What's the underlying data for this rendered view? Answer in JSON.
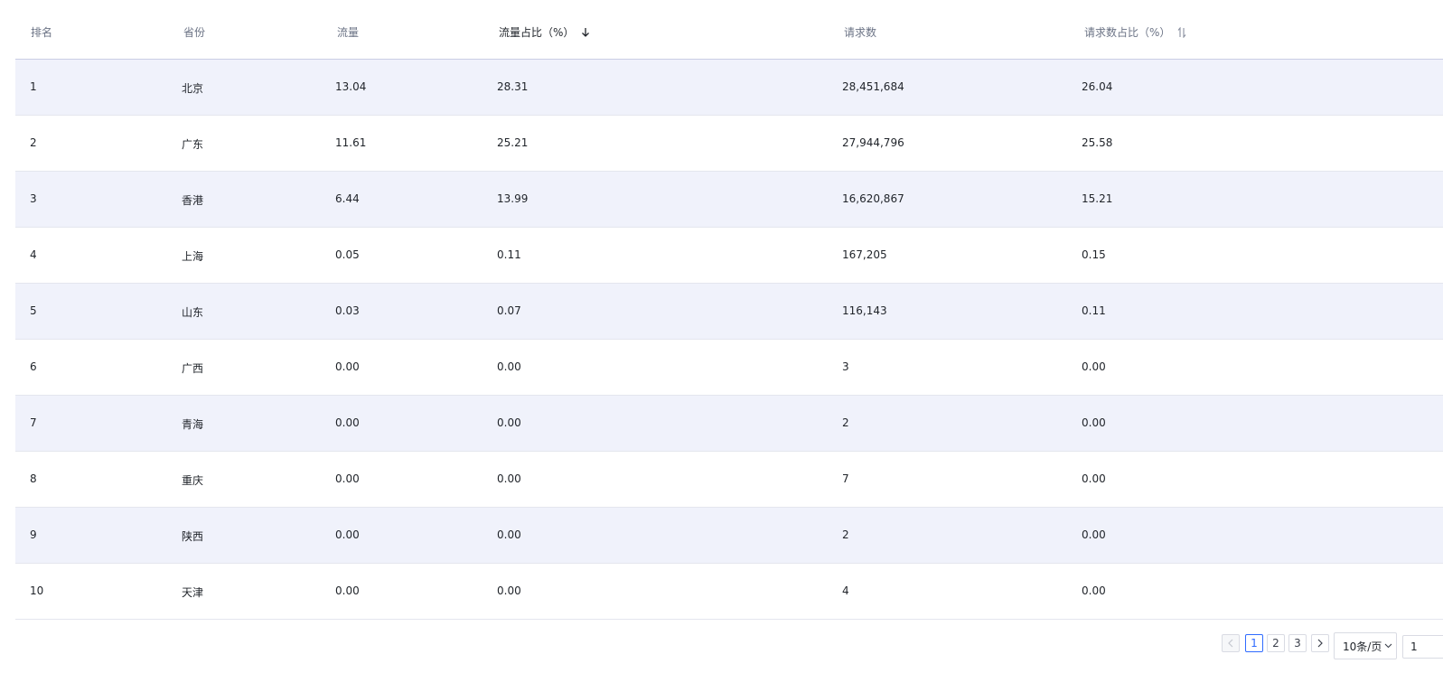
{
  "table": {
    "headers": [
      "排名",
      "省份",
      "流量",
      "流量占比（%）",
      "请求数",
      "请求数占比（%）"
    ],
    "rows": [
      [
        "1",
        "北京",
        "13.04",
        "28.31",
        "28,451,684",
        "26.04"
      ],
      [
        "2",
        "广东",
        "11.61",
        "25.21",
        "27,944,796",
        "25.58"
      ],
      [
        "3",
        "香港",
        "6.44",
        "13.99",
        "16,620,867",
        "15.21"
      ],
      [
        "4",
        "上海",
        "0.05",
        "0.11",
        "167,205",
        "0.15"
      ],
      [
        "5",
        "山东",
        "0.03",
        "0.07",
        "116,143",
        "0.11"
      ],
      [
        "6",
        "广西",
        "0.00",
        "0.00",
        "3",
        "0.00"
      ],
      [
        "7",
        "青海",
        "0.00",
        "0.00",
        "2",
        "0.00"
      ],
      [
        "8",
        "重庆",
        "0.00",
        "0.00",
        "7",
        "0.00"
      ],
      [
        "9",
        "陕西",
        "0.00",
        "0.00",
        "2",
        "0.00"
      ],
      [
        "10",
        "天津",
        "0.00",
        "0.00",
        "4",
        "0.00"
      ]
    ]
  },
  "pagination": {
    "pages": [
      "1",
      "2",
      "3"
    ],
    "current_page": "1",
    "page_size": "10条/页",
    "jump_value": "1"
  },
  "icons": {
    "sort_desc": "arrow-down-icon",
    "sort_both": "sort-toggle-icon",
    "prev": "chevron-left-icon",
    "next": "chevron-right-icon",
    "dropdown": "chevron-down-icon"
  },
  "colors": {
    "row_alt_bg": "#f0f2fb",
    "header_border": "#c9cde4",
    "accent": "#2f6bff"
  }
}
